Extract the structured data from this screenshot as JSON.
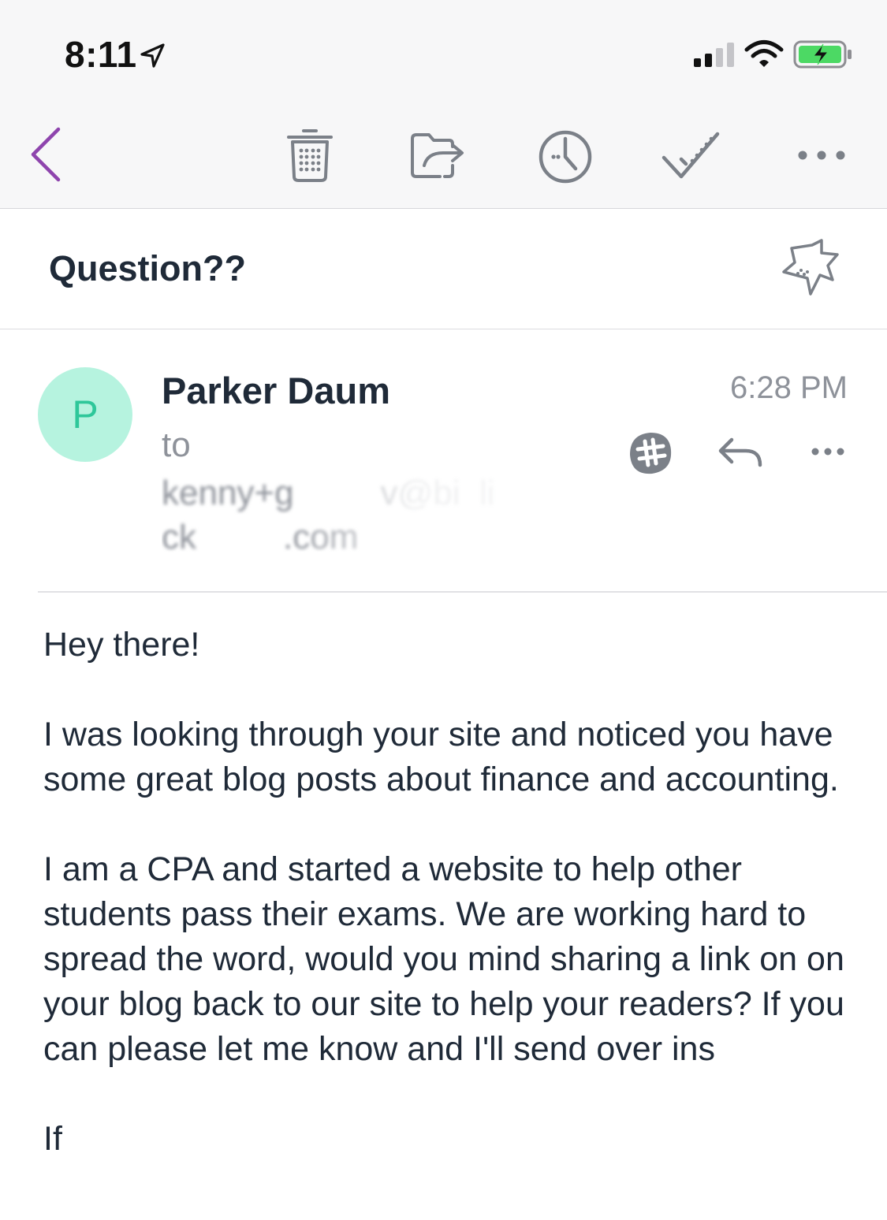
{
  "status_bar": {
    "time": "8:11"
  },
  "toolbar": {
    "icons": [
      "back-icon",
      "trash-icon",
      "move-icon",
      "clock-icon",
      "done-icon",
      "more-icon"
    ],
    "accent_color": "#8e44ad"
  },
  "subject": "Question??",
  "message": {
    "avatar_initial": "P",
    "sender": "Parker Daum",
    "time": "6:28 PM",
    "to_label": "to",
    "recipient": "kenny+g         v@bi  li\nck         .com"
  },
  "body": {
    "paragraphs": [
      "Hey there!",
      "I was looking through your site and noticed you have some great blog posts about finance and accounting.",
      "I am a CPA and started a website to help other students pass their exams. We are working hard to spread the word, would you mind sharing a link on on your blog back to our site to help your readers? If you can please let me know and I'll send over ins",
      "If"
    ]
  }
}
